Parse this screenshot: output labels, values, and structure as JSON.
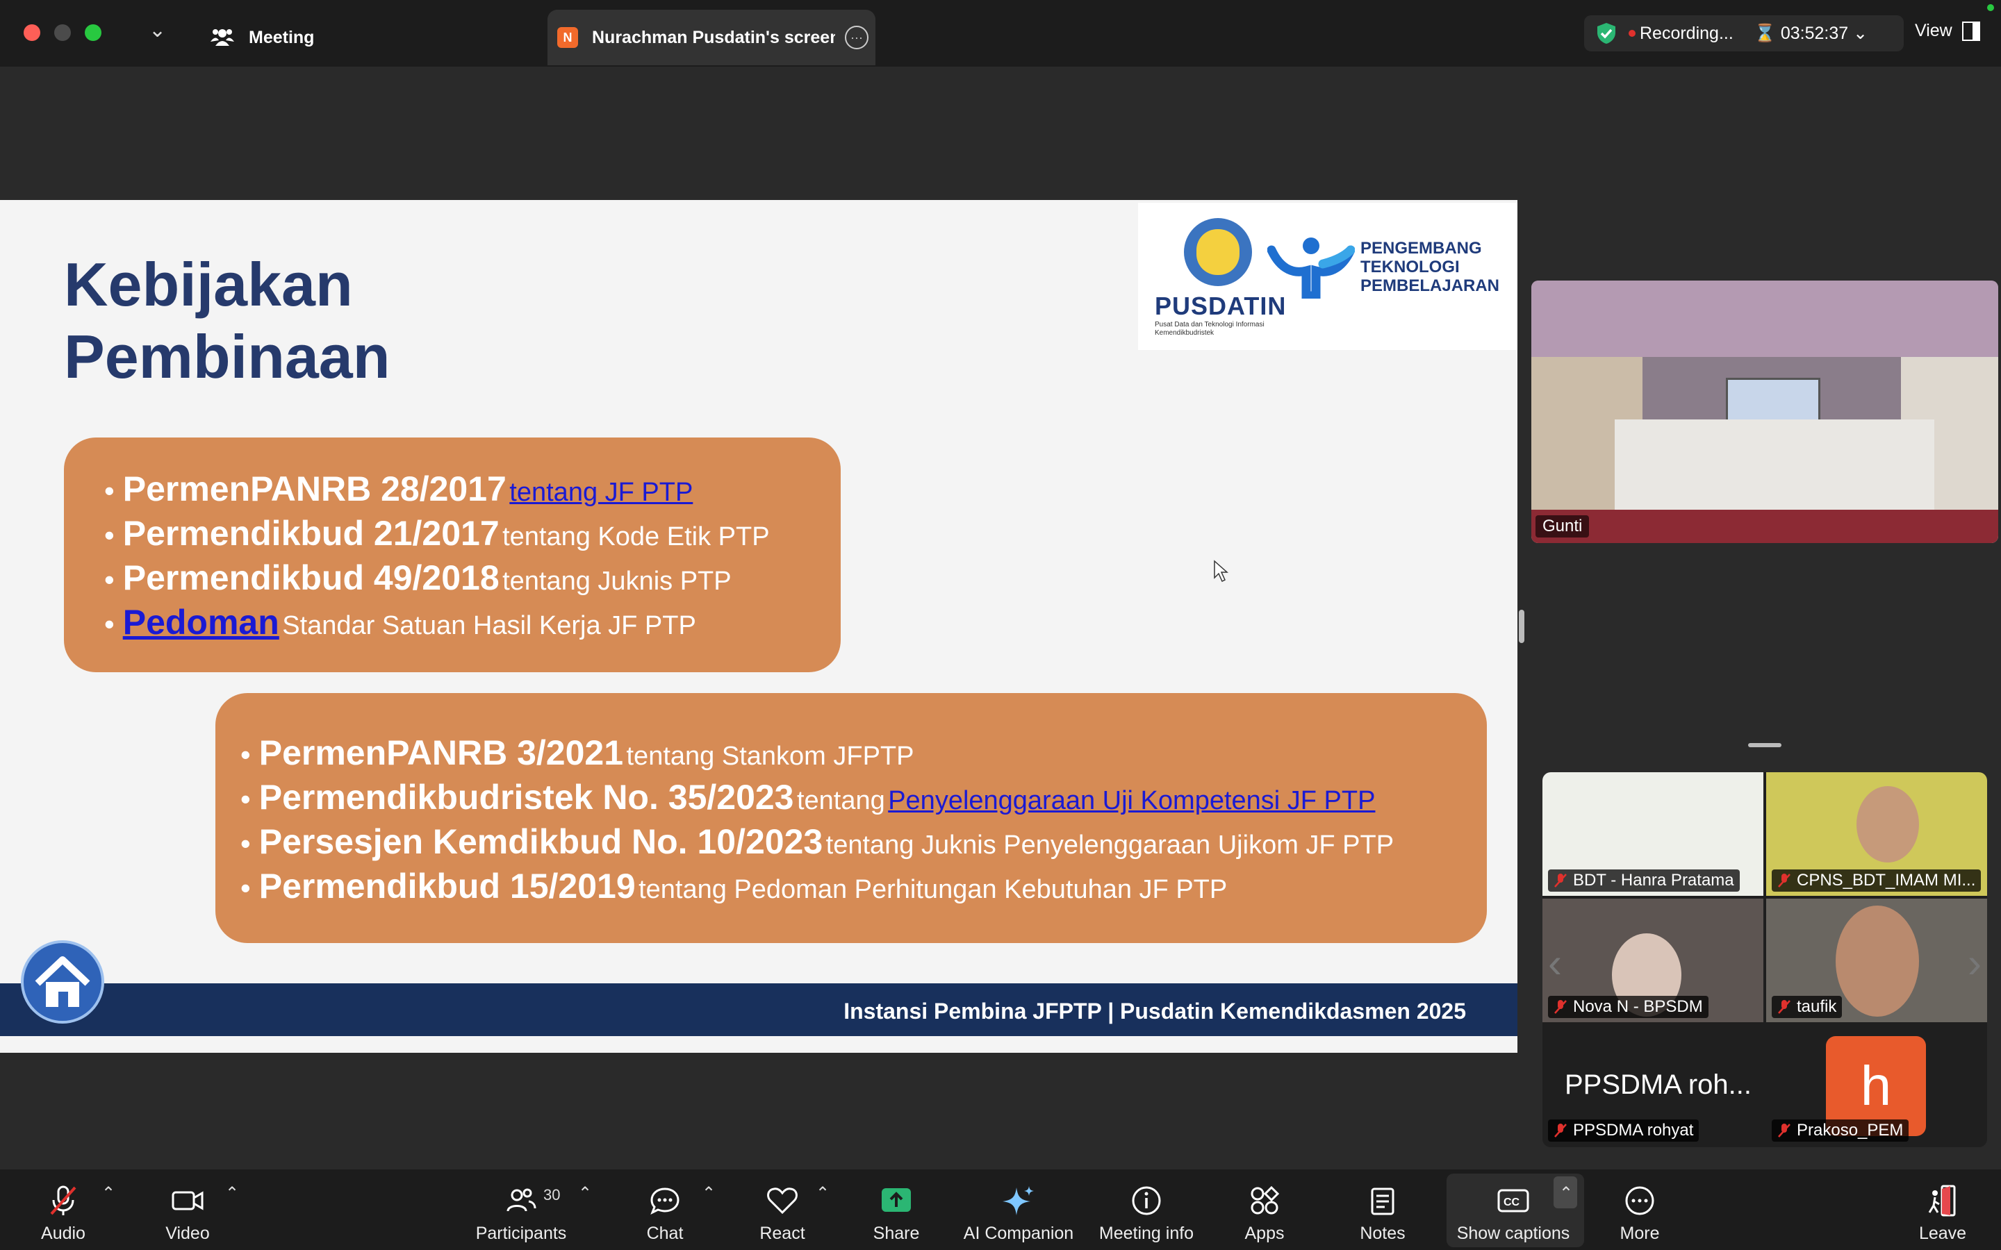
{
  "titlebar": {
    "meeting_tab": "Meeting",
    "share_tab": "Nurachman Pusdatin's screen",
    "share_badge": "N",
    "recording": "Recording...",
    "timer": "03:52:37",
    "view": "View"
  },
  "slide": {
    "title_line1": "Kebijakan",
    "title_line2": "Pembinaan",
    "logo": {
      "pusdatin": "PUSDATIN",
      "pusdatin_sub": "Pusat Data dan Teknologi Informasi Kemendikbudristek",
      "ptp_line1": "PENGEMBANG",
      "ptp_line2": "TEKNOLOGI",
      "ptp_line3": "PEMBELAJARAN"
    },
    "box1": [
      {
        "title": "PermenPANRB 28/2017",
        "desc": "tentang JF PTP"
      },
      {
        "title": "Permendikbud 21/2017",
        "desc": "tentang Kode Etik PTP"
      },
      {
        "title": "Permendikbud 49/2018",
        "desc": "tentang Juknis PTP"
      },
      {
        "title": "Pedoman",
        "desc": "Standar Satuan Hasil Kerja JF PTP"
      }
    ],
    "box2": [
      {
        "title": "PermenPANRB 3/2021",
        "desc": "tentang Stankom JFPTP"
      },
      {
        "title": "Permendikbudristek No. 35/2023",
        "desc_pre": "tentang",
        "desc_link": "Penyelenggaraan Uji Kompetensi JF PTP"
      },
      {
        "title": "Persesjen Kemdikbud No. 10/2023",
        "desc": "tentang Juknis Penyelenggaraan Ujikom  JF PTP"
      },
      {
        "title": "Permendikbud 15/2019",
        "desc": "tentang Pedoman Perhitungan Kebutuhan JF PTP"
      }
    ],
    "footer": "Instansi Pembina JFPTP | Pusdatin Kemendikdasmen 2025"
  },
  "participants_panel": {
    "main_video_name": "Gunti",
    "tiles": [
      {
        "name": "BDT - Hanra Pratama"
      },
      {
        "name": "CPNS_BDT_IMAM MI..."
      },
      {
        "name": "Nova N - BPSDM"
      },
      {
        "name": "taufik"
      }
    ],
    "big_name": "PPSDMA roh...",
    "bottom_left_name": "PPSDMA rohyat",
    "bottom_right_name": "Prakoso_PEM",
    "avatar_letter": "h"
  },
  "toolbar": {
    "audio": "Audio",
    "video": "Video",
    "participants": "Participants",
    "participants_count": "30",
    "chat": "Chat",
    "react": "React",
    "share": "Share",
    "ai": "AI Companion",
    "info": "Meeting info",
    "apps": "Apps",
    "notes": "Notes",
    "captions": "Show captions",
    "more": "More",
    "leave": "Leave"
  },
  "colors": {
    "slide_title": "#263a6c",
    "box": "#d68b55",
    "link": "#1a1ad4",
    "footer": "#18305c",
    "share_green": "#2bb673",
    "leave_red": "#e5484d"
  }
}
